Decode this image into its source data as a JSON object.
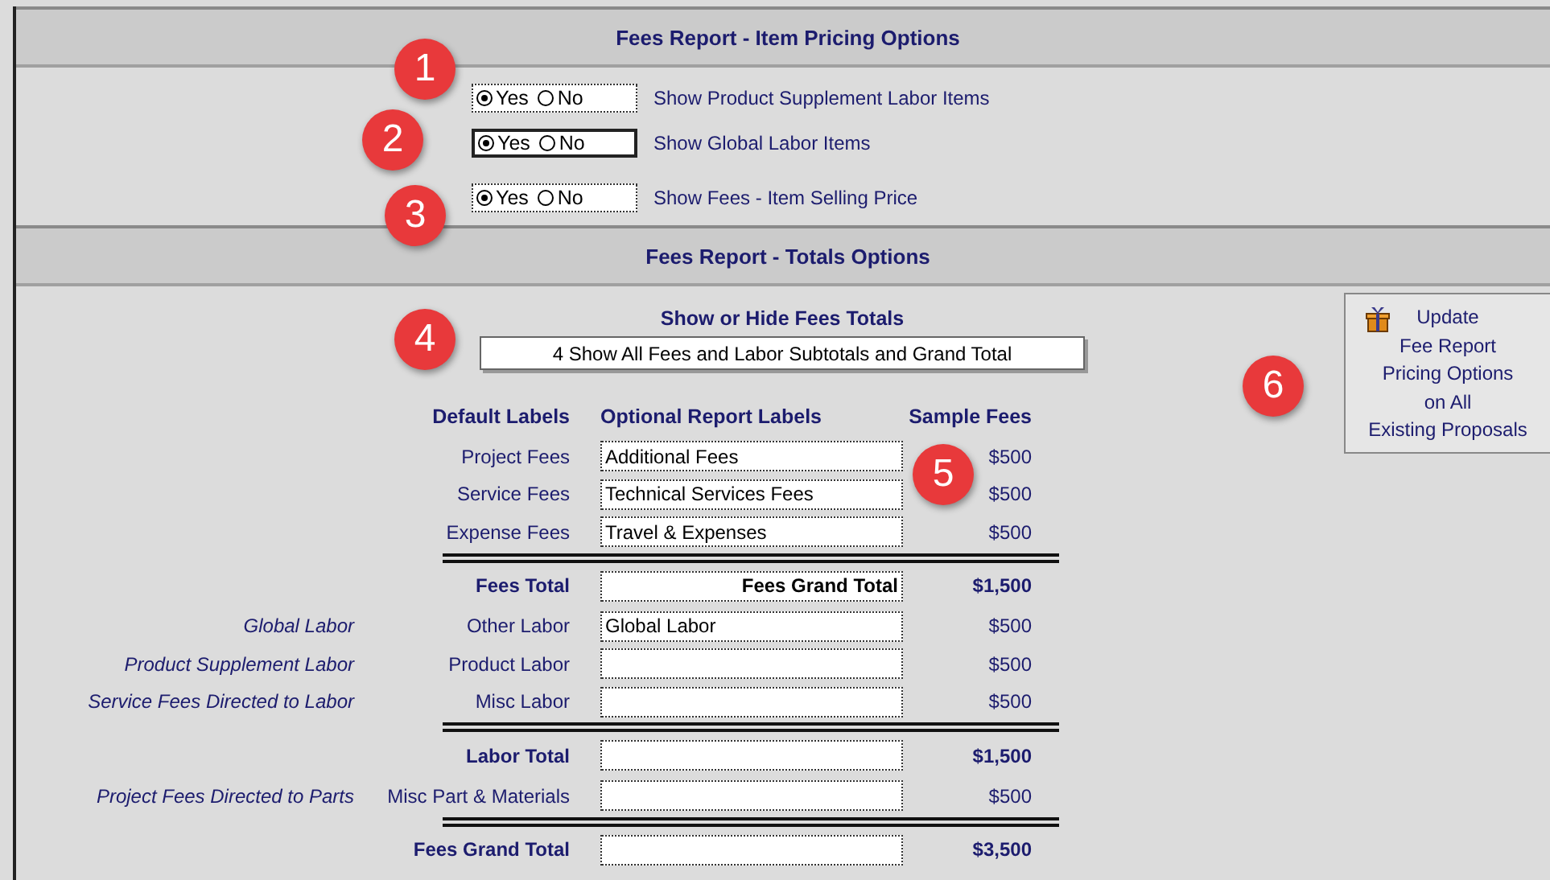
{
  "pricing_section": {
    "title": "Fees Report - Item Pricing Options"
  },
  "pricing_options": [
    {
      "options": [
        {
          "label": "Yes",
          "selected": true
        },
        {
          "label": "No",
          "selected": false
        }
      ],
      "focused": false,
      "description": "Show Product Supplement Labor Items"
    },
    {
      "options": [
        {
          "label": "Yes",
          "selected": true
        },
        {
          "label": "No",
          "selected": false
        }
      ],
      "focused": true,
      "description": "Show Global Labor Items"
    },
    {
      "options": [
        {
          "label": "Yes",
          "selected": true
        },
        {
          "label": "No",
          "selected": false
        }
      ],
      "focused": false,
      "description": "Show Fees - Item Selling Price"
    }
  ],
  "totals_section": {
    "title": "Fees Report - Totals Options"
  },
  "totals_dropdown": {
    "label": "Show or Hide Fees Totals",
    "value": "4 Show All Fees and Labor Subtotals and Grand Total"
  },
  "update_button": {
    "label": "Update\nFee Report\nPricing Options\non All\nExisting Proposals"
  },
  "table": {
    "columns": [
      "Default Labels",
      "Optional Report Labels",
      "Sample Fees"
    ],
    "rows": [
      {
        "kind": "item",
        "label": "Project Fees",
        "field": "Additional Fees",
        "fee": "$500"
      },
      {
        "kind": "item",
        "label": "Service Fees",
        "field": "Technical Services Fees",
        "fee": "$500"
      },
      {
        "kind": "item",
        "label": "Expense Fees",
        "field": "Travel & Expenses",
        "fee": "$500"
      },
      {
        "kind": "divider"
      },
      {
        "kind": "total",
        "label": "Fees Total",
        "field": "Fees Grand Total",
        "fee": "$1,500"
      },
      {
        "kind": "item",
        "source": "Global Labor",
        "label": "Other Labor",
        "field": "Global Labor",
        "fee": "$500"
      },
      {
        "kind": "item",
        "source": "Product Supplement Labor",
        "label": "Product Labor",
        "fee": "$500"
      },
      {
        "kind": "item",
        "source": "Service Fees Directed to Labor",
        "label": "Misc Labor",
        "fee": "$500"
      },
      {
        "kind": "divider"
      },
      {
        "kind": "total",
        "label": "Labor Total",
        "fee": "$1,500"
      },
      {
        "kind": "item",
        "source": "Project Fees Directed to Parts",
        "label": "Misc Part & Materials",
        "fee": "$500"
      },
      {
        "kind": "divider"
      },
      {
        "kind": "total",
        "label": "Fees Grand Total",
        "fee": "$3,500"
      }
    ]
  },
  "callouts": [
    {
      "number": "1"
    },
    {
      "number": "2"
    },
    {
      "number": "3"
    },
    {
      "number": "4"
    },
    {
      "number": "5"
    },
    {
      "number": "6"
    }
  ]
}
